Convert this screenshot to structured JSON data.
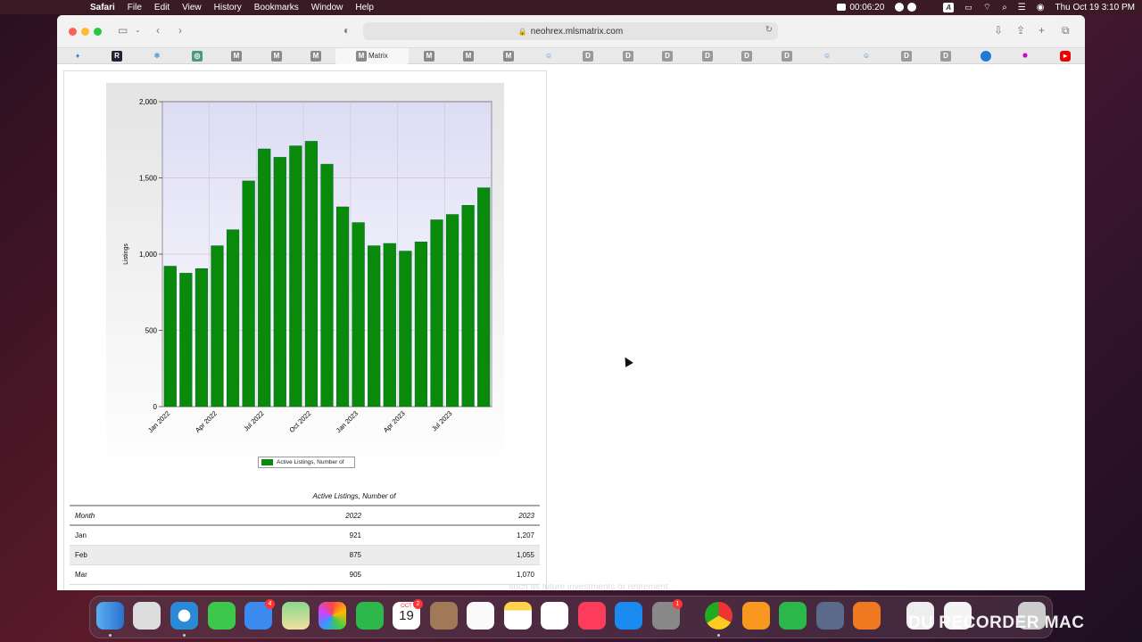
{
  "menubar": {
    "app": "Safari",
    "items": [
      "File",
      "Edit",
      "View",
      "History",
      "Bookmarks",
      "Window",
      "Help"
    ],
    "recording_time": "00:06:20",
    "input_badge": "A",
    "clock": "Thu Oct 19  3:10 PM"
  },
  "browser": {
    "url": "neohrex.mlsmatrix.com",
    "active_tab_label": "Matrix",
    "tab_letters": [
      "R",
      "M",
      "M",
      "M",
      "M",
      "M",
      "M",
      "M",
      "D",
      "D",
      "D",
      "D",
      "D",
      "D",
      "D",
      "D"
    ]
  },
  "chart_data": {
    "type": "bar",
    "title": "",
    "xlabel": "",
    "ylabel": "Listings",
    "ylim": [
      0,
      2000
    ],
    "yticks": [
      "0",
      "500",
      "1,000",
      "1,500",
      "2,000"
    ],
    "xtick_labels": [
      "Jan 2022",
      "Apr 2022",
      "Jul 2022",
      "Oct 2022",
      "Jan 2023",
      "Apr 2023",
      "Jul 2023"
    ],
    "categories": [
      "Jan 2022",
      "Feb 2022",
      "Mar 2022",
      "Apr 2022",
      "May 2022",
      "Jun 2022",
      "Jul 2022",
      "Aug 2022",
      "Sep 2022",
      "Oct 2022",
      "Nov 2022",
      "Dec 2022",
      "Jan 2023",
      "Feb 2023",
      "Mar 2023",
      "Apr 2023",
      "May 2023",
      "Jun 2023",
      "Jul 2023",
      "Aug 2023",
      "Sep 2023"
    ],
    "series": [
      {
        "name": "Active Listings, Number of",
        "color": "#0a8a0a",
        "values": [
          921,
          875,
          905,
          1055,
          1160,
          1480,
          1690,
          1635,
          1710,
          1740,
          1590,
          1310,
          1207,
          1055,
          1070,
          1020,
          1080,
          1225,
          1260,
          1320,
          1435
        ]
      }
    ],
    "legend_position": "bottom",
    "grid": true
  },
  "table": {
    "caption": "Active Listings, Number of",
    "headers": [
      "Month",
      "2022",
      "2023"
    ],
    "rows": [
      [
        "Jan",
        "921",
        "1,207"
      ],
      [
        "Feb",
        "875",
        "1,055"
      ],
      [
        "Mar",
        "905",
        "1,070"
      ]
    ]
  },
  "dock": {
    "calendar_month": "OCT",
    "calendar_day": "19",
    "mail_badge": "4",
    "calendar_badge": "2",
    "settings_badge": "1",
    "partial_caption": "such as future investments or retirement."
  },
  "watermark": "DU RECORDER MAC"
}
